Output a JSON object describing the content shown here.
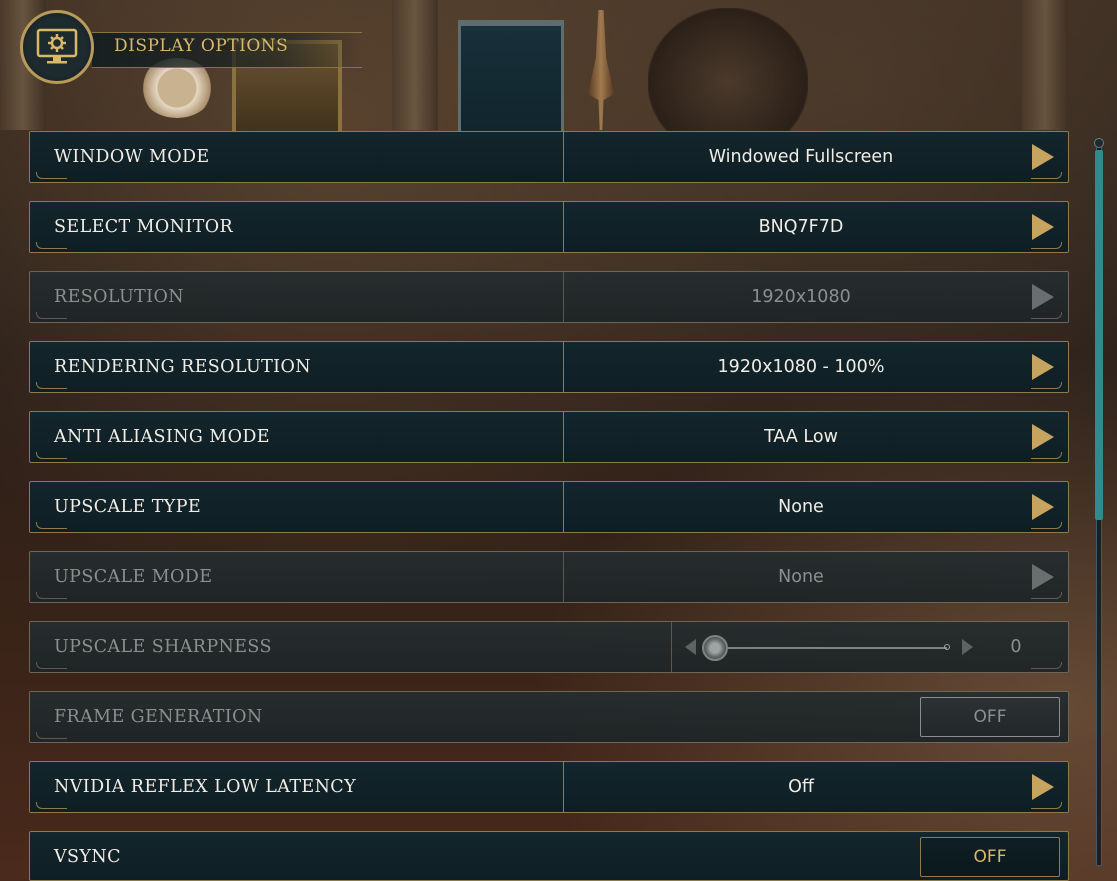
{
  "header": {
    "title": "DISPLAY OPTIONS",
    "icon": "monitor-gear-icon"
  },
  "settings": [
    {
      "label": "WINDOW MODE",
      "value": "Windowed Fullscreen",
      "type": "selector",
      "enabled": true
    },
    {
      "label": "SELECT MONITOR",
      "value": "BNQ7F7D",
      "type": "selector",
      "enabled": true
    },
    {
      "label": "RESOLUTION",
      "value": "1920x1080",
      "type": "selector",
      "enabled": false
    },
    {
      "label": "RENDERING RESOLUTION",
      "value": "1920x1080 - 100%",
      "type": "selector",
      "enabled": true
    },
    {
      "label": "ANTI ALIASING MODE",
      "value": "TAA Low",
      "type": "selector",
      "enabled": true
    },
    {
      "label": "UPSCALE TYPE",
      "value": "None",
      "type": "selector",
      "enabled": true
    },
    {
      "label": "UPSCALE MODE",
      "value": "None",
      "type": "selector",
      "enabled": false
    },
    {
      "label": "UPSCALE SHARPNESS",
      "value": "0",
      "type": "slider",
      "enabled": false,
      "slider_fraction": 0
    },
    {
      "label": "FRAME GENERATION",
      "value": "OFF",
      "type": "toggle",
      "enabled": false
    },
    {
      "label": "NVIDIA REFLEX LOW LATENCY",
      "value": "Off",
      "type": "selector",
      "enabled": true
    },
    {
      "label": "VSYNC",
      "value": "OFF",
      "type": "toggle",
      "enabled": true
    }
  ],
  "colors": {
    "accent_gold": "#d9b86a",
    "row_bg": "#13262c",
    "scroll_thumb": "#2e8b8e"
  }
}
